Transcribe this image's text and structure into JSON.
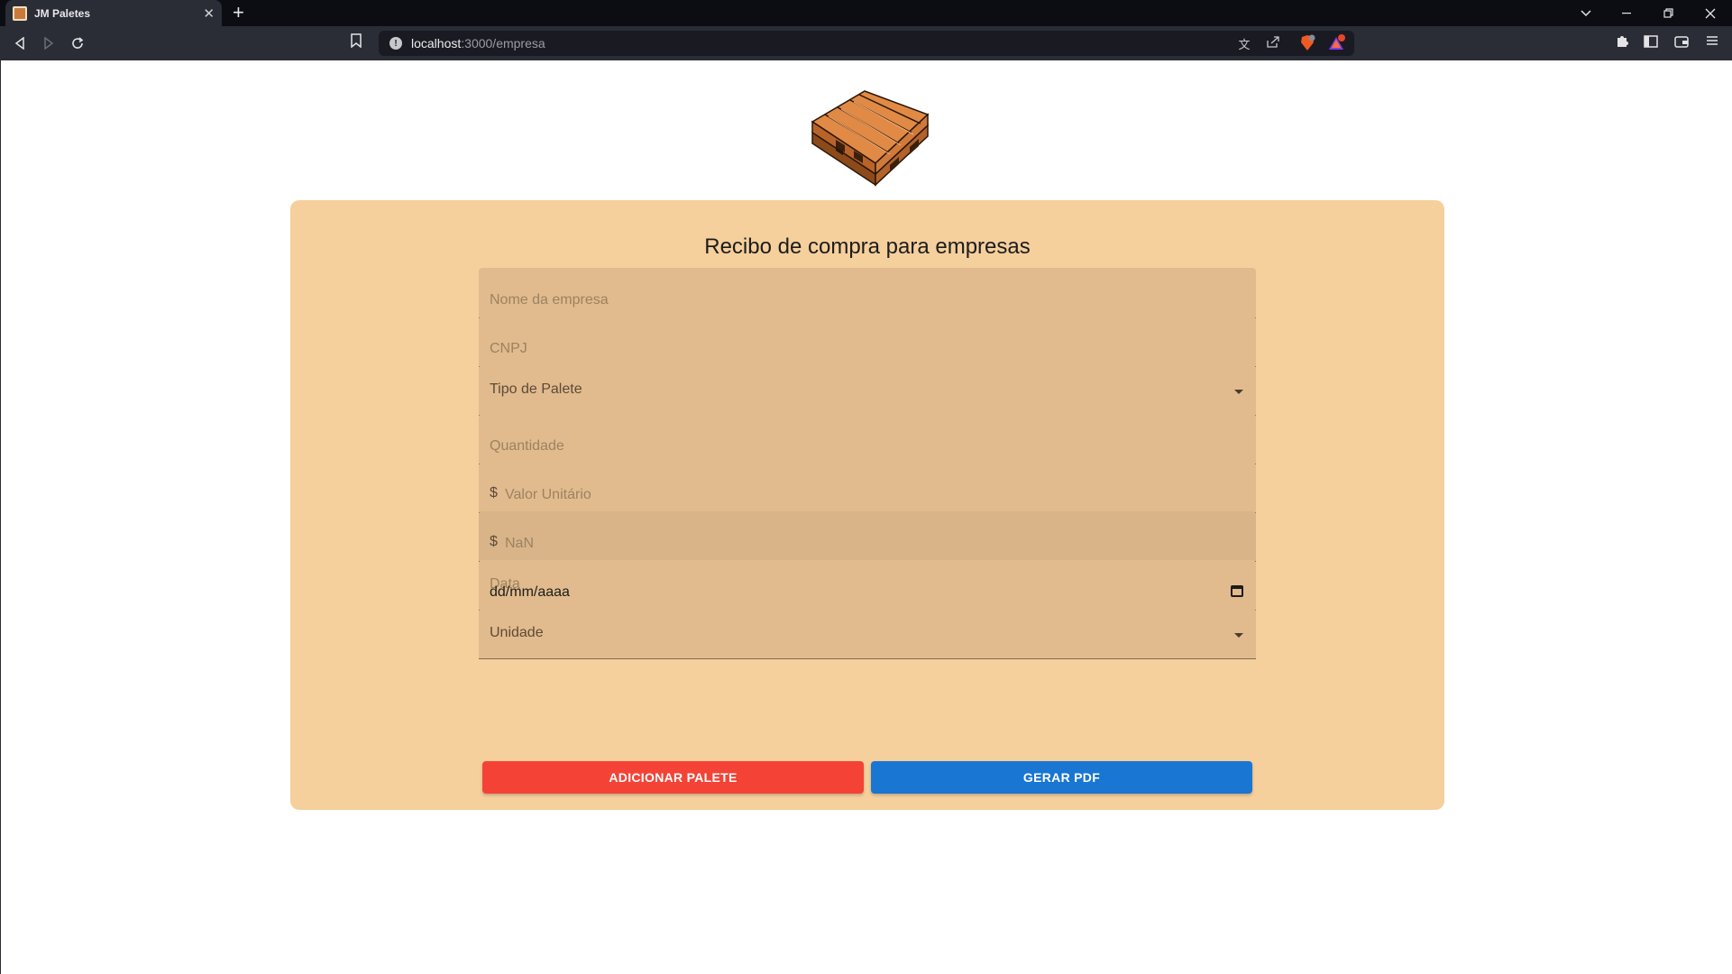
{
  "browser": {
    "tab_title": "JM Paletes",
    "new_tab": "+",
    "url_host": "localhost",
    "url_path": ":3000/empresa"
  },
  "page": {
    "title": "Recibo de compra para empresas",
    "fields": {
      "company_name_placeholder": "Nome da empresa",
      "cnpj_placeholder": "CNPJ",
      "pallet_type_label": "Tipo de Palete",
      "quantity_placeholder": "Quantidade",
      "unit_value_prefix": "$",
      "unit_value_placeholder": "Valor Unitário",
      "total_prefix": "$",
      "total_value": "NaN",
      "date_label": "Data",
      "date_value": "dd/mm/aaaa",
      "unit_label": "Unidade"
    },
    "buttons": {
      "add_pallet": "ADICIONAR PALETE",
      "generate_pdf": "GERAR PDF"
    }
  },
  "colors": {
    "card_background": "#f5cf9c",
    "field_background": "#e1bb8d",
    "add_button": "#f44336",
    "pdf_button": "#1976d2"
  }
}
